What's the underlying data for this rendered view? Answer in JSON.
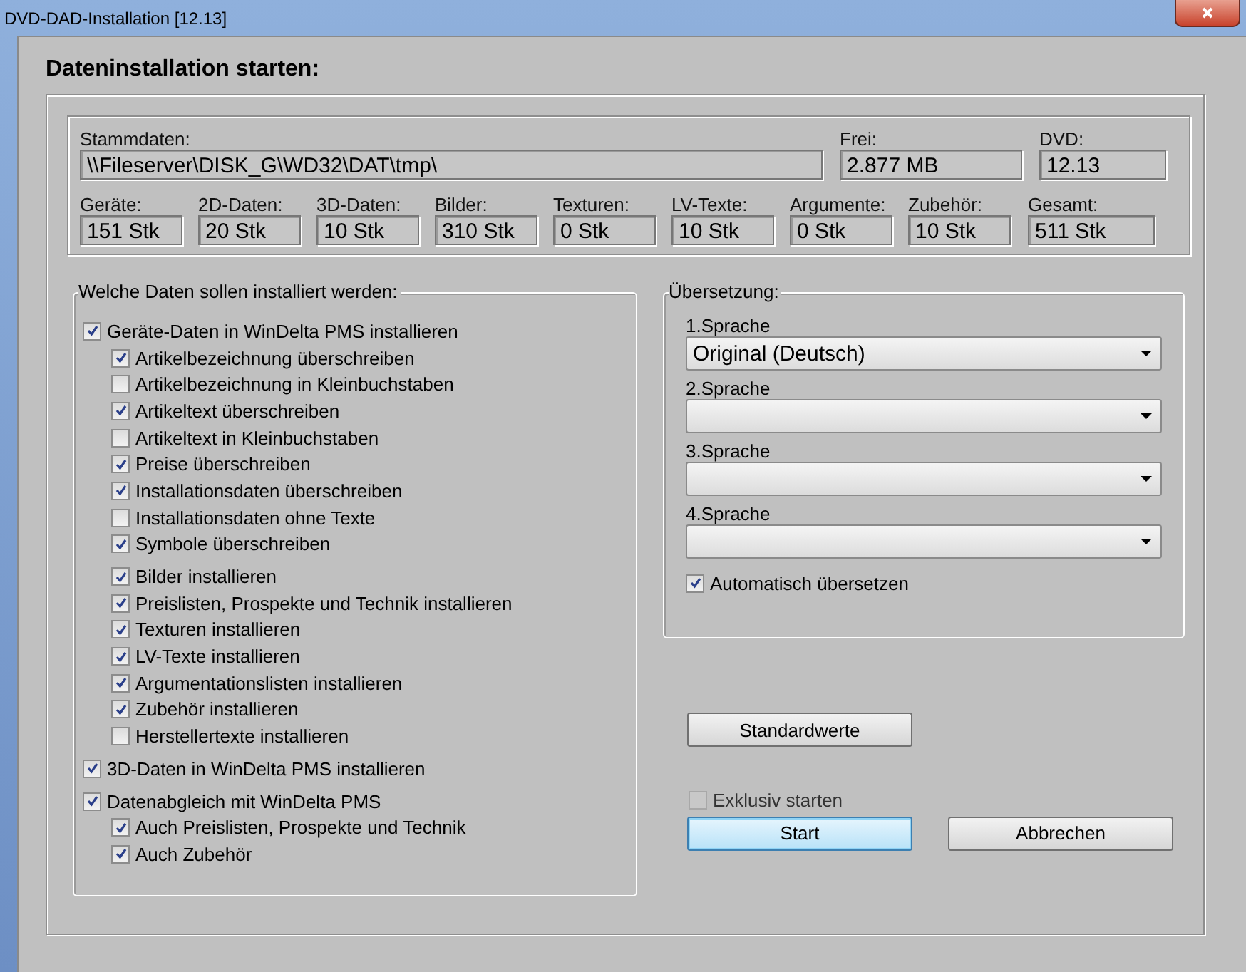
{
  "window": {
    "title": "DVD-DAD-Installation [12.13]"
  },
  "heading": "Dateninstallation starten:",
  "master": {
    "path_label": "Stammdaten:",
    "path": "\\\\Fileserver\\DISK_G\\WD32\\DAT\\tmp\\",
    "free_label": "Frei:",
    "free": "2.877 MB",
    "dvd_label": "DVD:",
    "dvd": "12.13"
  },
  "counts": [
    {
      "label": "Geräte:",
      "value": "151 Stk"
    },
    {
      "label": "2D-Daten:",
      "value": "20 Stk"
    },
    {
      "label": "3D-Daten:",
      "value": "10 Stk"
    },
    {
      "label": "Bilder:",
      "value": "310 Stk"
    },
    {
      "label": "Texturen:",
      "value": "0 Stk"
    },
    {
      "label": "LV-Texte:",
      "value": "10 Stk"
    },
    {
      "label": "Argumente:",
      "value": "0 Stk"
    },
    {
      "label": "Zubehör:",
      "value": "10 Stk"
    },
    {
      "label": "Gesamt:",
      "value": "511 Stk"
    }
  ],
  "install": {
    "legend": "Welche Daten sollen installiert werden:",
    "options": [
      {
        "label": "Geräte-Daten in WinDelta PMS installieren",
        "checked": true,
        "children": [
          {
            "label": "Artikelbezeichnung überschreiben",
            "checked": true
          },
          {
            "label": "Artikelbezeichnung in Kleinbuchstaben",
            "checked": false
          },
          {
            "label": "Artikeltext überschreiben",
            "checked": true
          },
          {
            "label": "Artikeltext in Kleinbuchstaben",
            "checked": false
          },
          {
            "label": "Preise überschreiben",
            "checked": true
          },
          {
            "label": "Installationsdaten überschreiben",
            "checked": true
          },
          {
            "label": "Installationsdaten ohne Texte",
            "checked": false
          },
          {
            "label": "Symbole überschreiben",
            "checked": true
          },
          {
            "label": "Bilder installieren",
            "checked": true
          },
          {
            "label": "Preislisten, Prospekte und Technik installieren",
            "checked": true
          },
          {
            "label": "Texturen installieren",
            "checked": true
          },
          {
            "label": "LV-Texte installieren",
            "checked": true
          },
          {
            "label": "Argumentationslisten installieren",
            "checked": true
          },
          {
            "label": "Zubehör installieren",
            "checked": true
          },
          {
            "label": "Herstellertexte installieren",
            "checked": false
          }
        ]
      },
      {
        "label": "3D-Daten in WinDelta PMS installieren",
        "checked": true
      },
      {
        "label": "Datenabgleich mit WinDelta PMS",
        "checked": true,
        "children": [
          {
            "label": "Auch Preislisten, Prospekte und Technik",
            "checked": true
          },
          {
            "label": "Auch Zubehör",
            "checked": true
          }
        ]
      }
    ]
  },
  "translation": {
    "legend": "Übersetzung:",
    "languages": [
      {
        "label": "1.Sprache",
        "value": "Original (Deutsch)"
      },
      {
        "label": "2.Sprache"
      },
      {
        "label": "3.Sprache"
      },
      {
        "label": "4.Sprache"
      }
    ],
    "auto": {
      "label": "Automatisch übersetzen",
      "checked": true
    }
  },
  "defaults_button": "Standardwerte",
  "exclusive": {
    "label": "Exklusiv starten",
    "checked": false,
    "disabled": true
  },
  "buttons": [
    {
      "label": "Start",
      "default": true
    },
    {
      "label": "Abbrechen",
      "default": false
    }
  ]
}
